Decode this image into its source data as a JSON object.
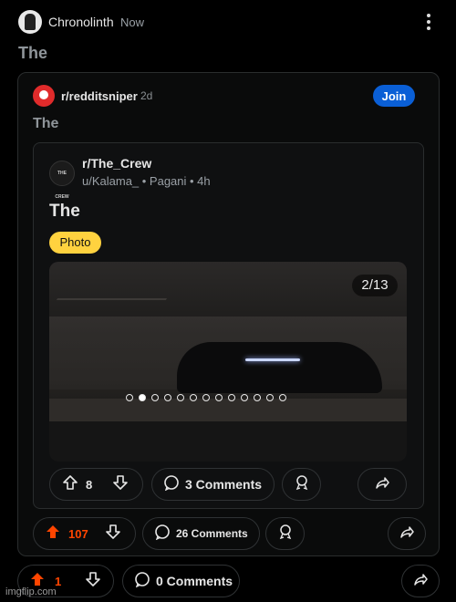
{
  "post": {
    "author": "Chronolinth",
    "time": "Now",
    "title": "The"
  },
  "crosspost1": {
    "subreddit": "r/redditsniper",
    "time": "2d",
    "join_label": "Join",
    "title": "The"
  },
  "crosspost2": {
    "subreddit": "r/The_Crew",
    "icon_text": "THE CREW",
    "meta": "u/Kalama_ • Pagani • 4h",
    "title": "The",
    "flair": "Photo",
    "gallery_counter": "2/13",
    "gallery_total": 13,
    "gallery_index": 2,
    "upvotes": "8",
    "comments": "3 Comments"
  },
  "crosspost1_actions": {
    "upvotes": "107",
    "comments": "26 Comments"
  },
  "post_actions": {
    "upvotes": "1",
    "comments": "0 Comments"
  },
  "watermark": "imgflip.com",
  "colors": {
    "upvote_active": "#ff4500",
    "join": "#0a5fd6",
    "flair": "#ffd23f"
  }
}
